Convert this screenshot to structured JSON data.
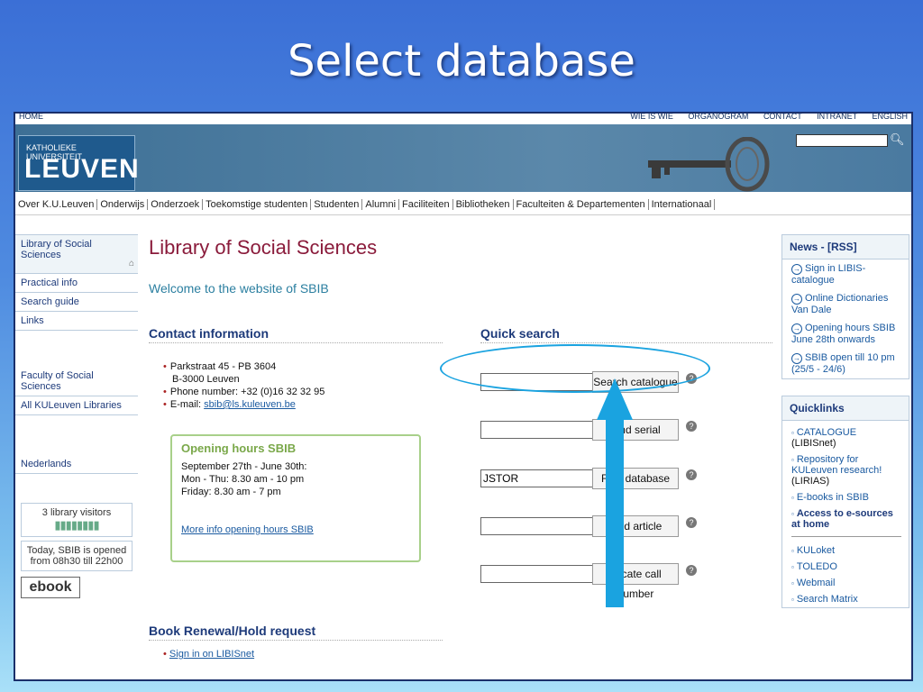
{
  "slide": {
    "title": "Select database"
  },
  "topbar": {
    "home": "HOME",
    "links": [
      "WIE IS WIE",
      "ORGANOGRAM",
      "CONTACT",
      "INTRANET",
      "ENGLISH"
    ]
  },
  "header": {
    "logo_small": "KATHOLIEKE UNIVERSITEIT",
    "logo_big": "LEUVEN",
    "search_value": ""
  },
  "nav": {
    "items": [
      "Over K.U.Leuven",
      "Onderwijs",
      "Onderzoek",
      "Toekomstige studenten",
      "Studenten",
      "Alumni",
      "Faciliteiten",
      "Bibliotheken",
      "Faculteiten & Departementen",
      "Internationaal"
    ]
  },
  "sidebar": {
    "items": [
      "Library of Social Sciences",
      "Practical info",
      "Search guide",
      "Links"
    ],
    "links2": [
      "Faculty of Social Sciences",
      "All KULeuven Libraries"
    ],
    "language": "Nederlands",
    "visitors": "3 library visitors",
    "opened": "Today, SBIB is opened from 08h30 till 22h00",
    "ebook": "ebook"
  },
  "main": {
    "title": "Library of Social Sciences",
    "welcome": "Welcome to the website of SBIB",
    "contact_heading": "Contact information",
    "address1": "Parkstraat 45 - PB 3604",
    "address2": "B-3000 Leuven",
    "phone": "Phone number: +32 (0)16 32 32 95",
    "email_label": "E-mail: ",
    "email": "sbib@ls.kuleuven.be",
    "hours_title": "Opening hours SBIB",
    "hours_line1": "September 27th - June 30th:",
    "hours_line2": "Mon - Thu: 8.30 am - 10 pm",
    "hours_line3": "Friday: 8.30 am - 7 pm",
    "hours_link": "More info opening hours SBIB",
    "renew_heading": "Book Renewal/Hold request",
    "renew_link": "Sign in on LIBISnet"
  },
  "quick_search": {
    "heading": "Quick search",
    "rows": [
      {
        "value": "",
        "button": "Search catalogue"
      },
      {
        "value": "",
        "button": "Find serial"
      },
      {
        "value": "JSTOR",
        "button": "Find database"
      },
      {
        "value": "",
        "button": "Find article"
      },
      {
        "value": "",
        "button": "Locate call number"
      }
    ]
  },
  "news": {
    "title": "News - [RSS]",
    "items": [
      "Sign in LIBIS-catalogue",
      "Online Dictionaries Van Dale",
      "Opening hours SBIB June 28th onwards",
      "SBIB open till 10 pm (25/5 - 24/6)"
    ]
  },
  "quicklinks": {
    "title": "Quicklinks",
    "item1_link": "CATALOGUE",
    "item1_suffix": " (LIBISnet)",
    "item2_link": "Repository for KULeuven research!",
    "item2_suffix": " (LIRIAS)",
    "item3": "E-books in SBIB",
    "item4": "Access to e-sources at home",
    "items2": [
      "KULoket",
      "TOLEDO",
      "Webmail",
      "Search Matrix"
    ]
  },
  "colors": {
    "highlight_ring": "#1aa3e0",
    "arrow": "#1aa3e0"
  }
}
